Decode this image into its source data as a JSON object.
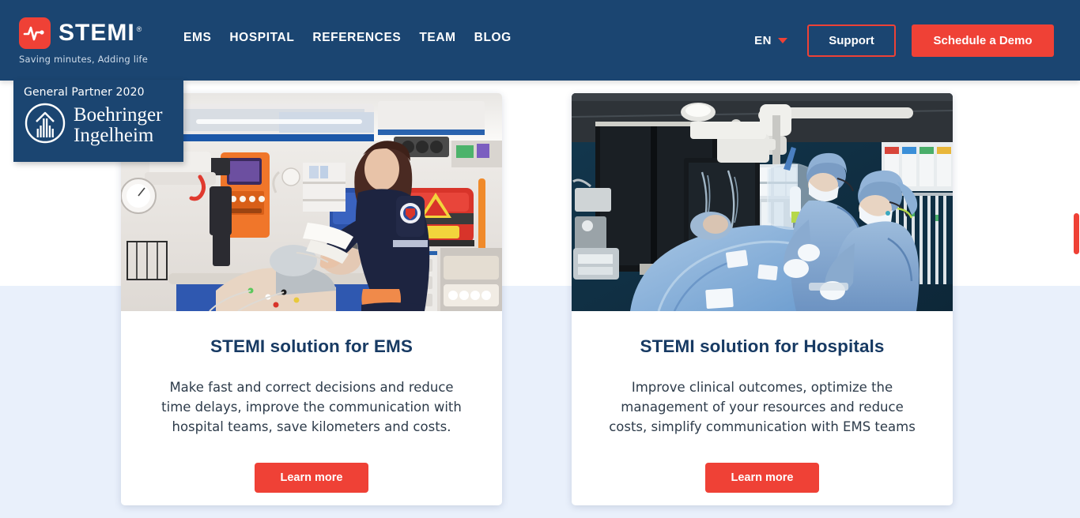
{
  "header": {
    "logo": {
      "icon": "ecg-heartbeat-icon",
      "wordmark": "STEMI",
      "registered": "®",
      "tagline": "Saving minutes, Adding life",
      "mark_color": "#ef4136",
      "bar_color": "#1b4571"
    },
    "nav": [
      {
        "label": "EMS"
      },
      {
        "label": "HOSPITAL"
      },
      {
        "label": "REFERENCES"
      },
      {
        "label": "TEAM"
      },
      {
        "label": "BLOG"
      }
    ],
    "language": {
      "label": "EN",
      "caret_icon": "chevron-down-icon"
    },
    "support_label": "Support",
    "demo_label": "Schedule a Demo"
  },
  "partner_badge": {
    "title": "General Partner 2020",
    "logo_icon": "boehringer-ingelheim-mark-icon",
    "name_line1": "Boehringer",
    "name_line2": "Ingelheim"
  },
  "cards": [
    {
      "photo_alt": "paramedic attending patient inside ambulance",
      "title": "STEMI solution for EMS",
      "text": "Make fast and correct decisions and reduce time delays, improve the communication with hospital teams, save kilometers and costs.",
      "cta_label": "Learn more"
    },
    {
      "photo_alt": "surgical team in hospital cath lab operating room",
      "title": "STEMI solution for Hospitals",
      "text": "Improve clinical outcomes, optimize the management of your resources and reduce costs, simplify communication with EMS teams",
      "cta_label": "Learn more"
    }
  ],
  "colors": {
    "navy": "#1b4571",
    "red": "#ef4136",
    "section_blue": "#e9f0fb",
    "heading_navy": "#173a63"
  }
}
